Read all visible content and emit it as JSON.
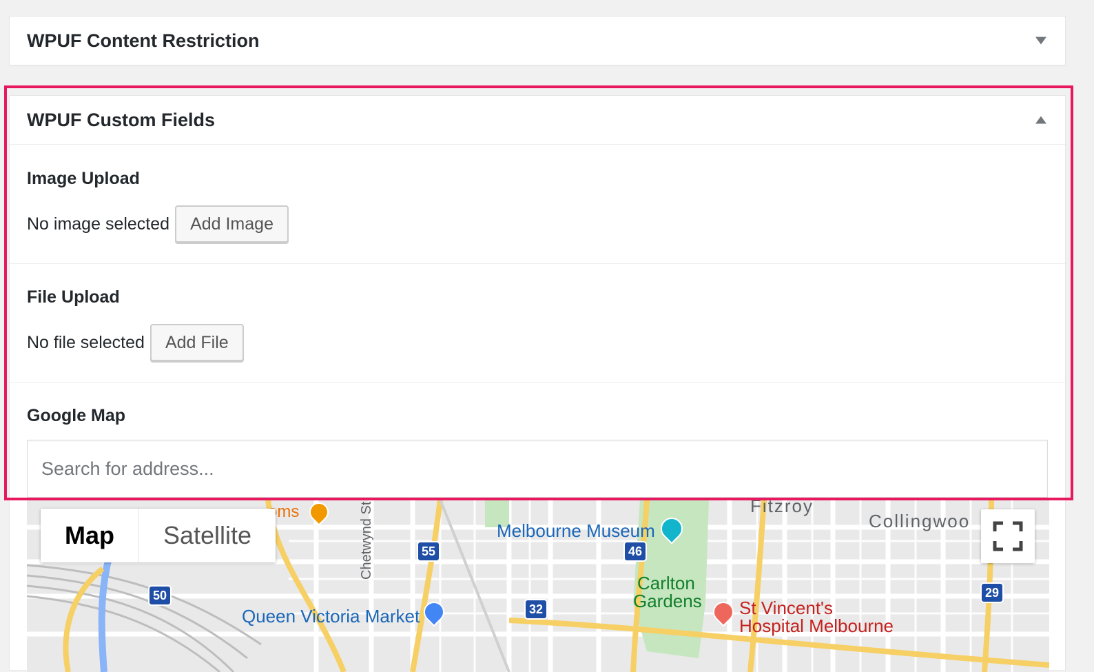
{
  "restriction_box": {
    "title": "WPUF Content Restriction",
    "toggle_icon": "arrow-down-icon"
  },
  "custom_fields_box": {
    "title": "WPUF Custom Fields",
    "toggle_icon": "arrow-up-icon",
    "image_upload": {
      "label": "Image Upload",
      "status": "No image selected",
      "button": "Add Image"
    },
    "file_upload": {
      "label": "File Upload",
      "status": "No file selected",
      "button": "Add File"
    },
    "google_map": {
      "label": "Google Map",
      "search_placeholder": "Search for address...",
      "map_type_options": [
        "Map",
        "Satellite"
      ],
      "map_type_selected": "Map",
      "fullscreen_icon": "fullscreen-icon",
      "places": {
        "fitzroy": "Fitzroy",
        "collingwood": "Collingwoo",
        "melbourne_museum": "Melbourne Museum",
        "carlton": "Carlton",
        "gardens": "Gardens",
        "st_vincents": "St Vincent's",
        "hospital": "Hospital Melbourne",
        "queen_victoria": "Queen Victoria Market",
        "chetwynd": "Chetwynd St",
        "oms": "oms"
      },
      "route_shields": [
        "55",
        "46",
        "50",
        "32",
        "29"
      ]
    }
  },
  "colors": {
    "highlight": "#e8185f",
    "map_label_blue": "#1a66b8",
    "road_yellow": "#f6cf65"
  }
}
